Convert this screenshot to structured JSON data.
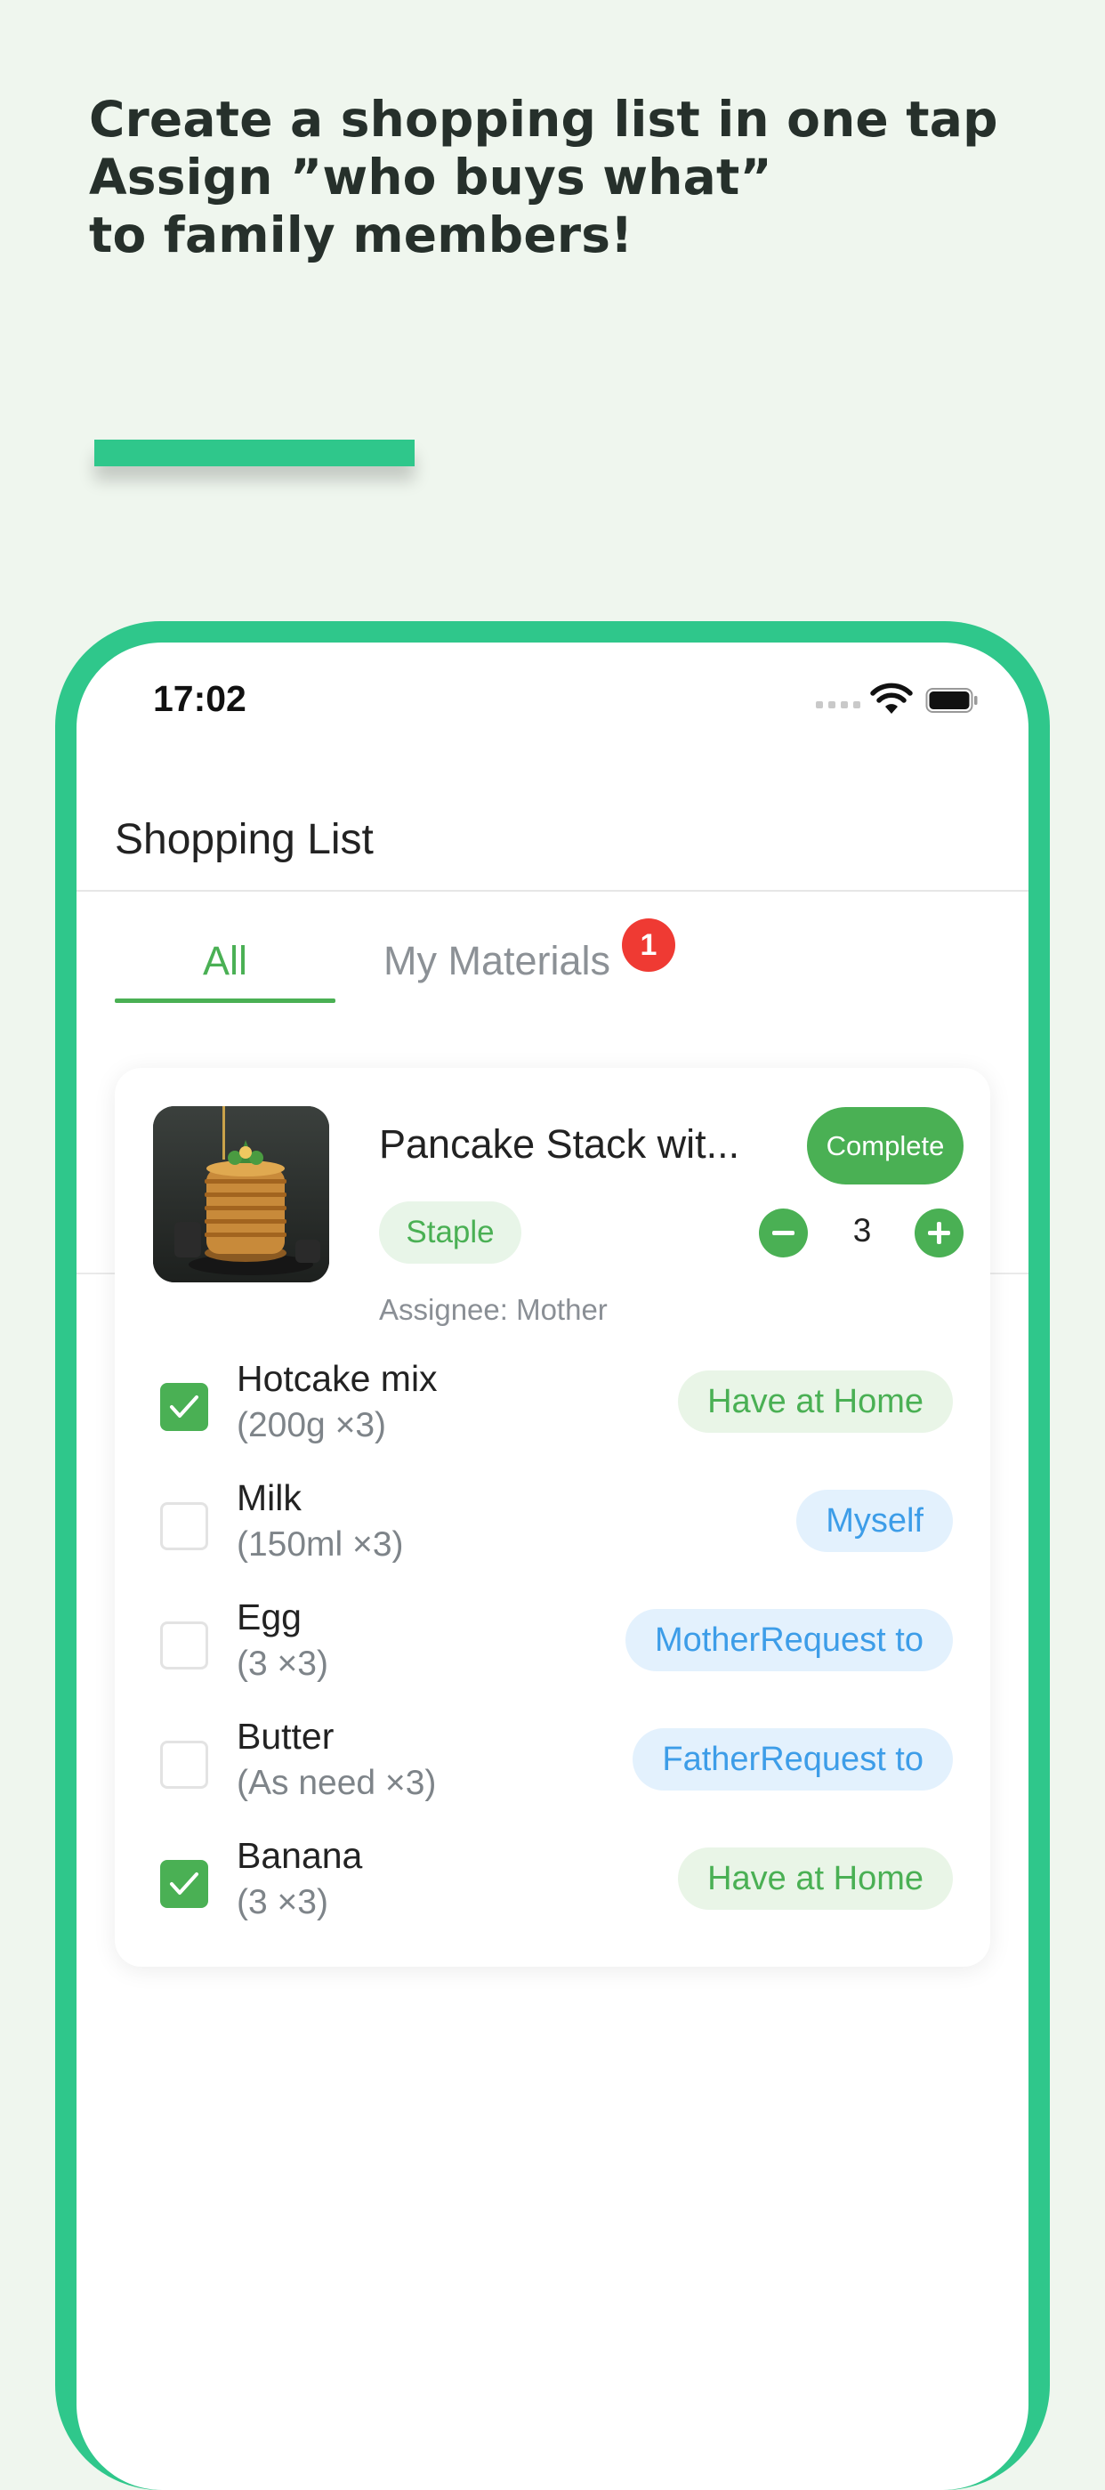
{
  "promo": {
    "lines": [
      "Create a shopping list in one tap",
      "Assign ”who buys what”",
      "to family members!"
    ]
  },
  "status_bar": {
    "time": "17:02"
  },
  "nav": {
    "title": "Shopping List"
  },
  "tabs": [
    {
      "label": "All",
      "active": true
    },
    {
      "label": "My Materials",
      "badge": "1"
    }
  ],
  "recipe": {
    "title": "Pancake Stack wit...",
    "complete_label": "Complete",
    "tag": "Staple",
    "quantity": "3",
    "assignee": "Assignee: Mother",
    "ingredients": [
      {
        "name": "Hotcake mix",
        "qty": "(200g ×3)",
        "checked": true,
        "tag": "Have at Home",
        "tag_type": "home"
      },
      {
        "name": "Milk",
        "qty": "(150ml ×3)",
        "checked": false,
        "tag": "Myself",
        "tag_type": "assign"
      },
      {
        "name": "Egg",
        "qty": "(3 ×3)",
        "checked": false,
        "tag": "MotherRequest to",
        "tag_type": "assign"
      },
      {
        "name": "Butter",
        "qty": "(As need ×3)",
        "checked": false,
        "tag": "FatherRequest to",
        "tag_type": "assign"
      },
      {
        "name": "Banana",
        "qty": "(3 ×3)",
        "checked": true,
        "tag": "Have at Home",
        "tag_type": "home"
      }
    ]
  },
  "colors": {
    "brand_green": "#2fc78b",
    "accent_green": "#4ab054",
    "badge_red": "#ef3a33",
    "assign_blue": "#3d9de8",
    "background": "#eff6ee"
  }
}
